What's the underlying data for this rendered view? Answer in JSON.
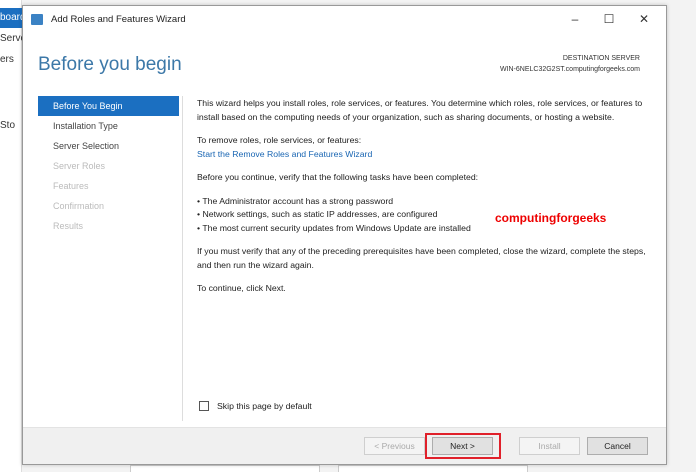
{
  "background": {
    "items": [
      "board",
      "Server",
      "ers",
      "Sto"
    ]
  },
  "window": {
    "title": "Add Roles and Features Wizard",
    "minimize": "–",
    "maximize": "☐",
    "close": "✕"
  },
  "heading": "Before you begin",
  "destination": {
    "label": "DESTINATION SERVER",
    "server": "WIN-6NELC32G2ST.computingforgeeks.com"
  },
  "nav": [
    {
      "label": "Before You Begin",
      "state": "selected"
    },
    {
      "label": "Installation Type",
      "state": "enabled"
    },
    {
      "label": "Server Selection",
      "state": "enabled"
    },
    {
      "label": "Server Roles",
      "state": "disabled"
    },
    {
      "label": "Features",
      "state": "disabled"
    },
    {
      "label": "Confirmation",
      "state": "disabled"
    },
    {
      "label": "Results",
      "state": "disabled"
    }
  ],
  "content": {
    "intro": "This wizard helps you install roles, role services, or features. You determine which roles, role services, or features to install based on the computing needs of your organization, such as sharing documents, or hosting a website.",
    "remove_label": "To remove roles, role services, or features:",
    "remove_link": "Start the Remove Roles and Features Wizard",
    "verify": "Before you continue, verify that the following tasks have been completed:",
    "tasks": [
      "The Administrator account has a strong password",
      "Network settings, such as static IP addresses, are configured",
      "The most current security updates from Windows Update are installed"
    ],
    "prereq": "If you must verify that any of the preceding prerequisites have been completed, close the wizard, complete the steps, and then run the wizard again.",
    "continue": "To continue, click Next."
  },
  "watermark": "computingforgeeks",
  "skip_label": "Skip this page by default",
  "buttons": {
    "previous": "< Previous",
    "next": "Next >",
    "install": "Install",
    "cancel": "Cancel"
  }
}
